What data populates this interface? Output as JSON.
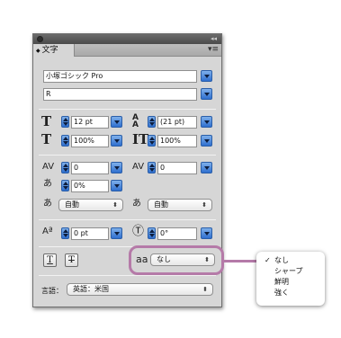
{
  "panel": {
    "tab_label": "文字",
    "font_family": "小塚ゴシック Pro",
    "font_style": "R",
    "font_size": "12 pt",
    "leading": "(21 pt)",
    "vertical_scale": "100%",
    "horizontal_scale": "100%",
    "kerning": "0",
    "tracking": "0",
    "tsume": "0%",
    "aki_left": "自動",
    "aki_right": "自動",
    "baseline_shift": "0 pt",
    "rotation": "0°",
    "antialias": "なし",
    "language_label": "言語：",
    "language": "英語：米国"
  },
  "antialias_menu": {
    "check": "✓",
    "items": [
      "なし",
      "シャープ",
      "鮮明",
      "強く"
    ]
  },
  "colors": {
    "highlight": "#b57aa8",
    "dropdown_blue": "#2f6fcf"
  }
}
